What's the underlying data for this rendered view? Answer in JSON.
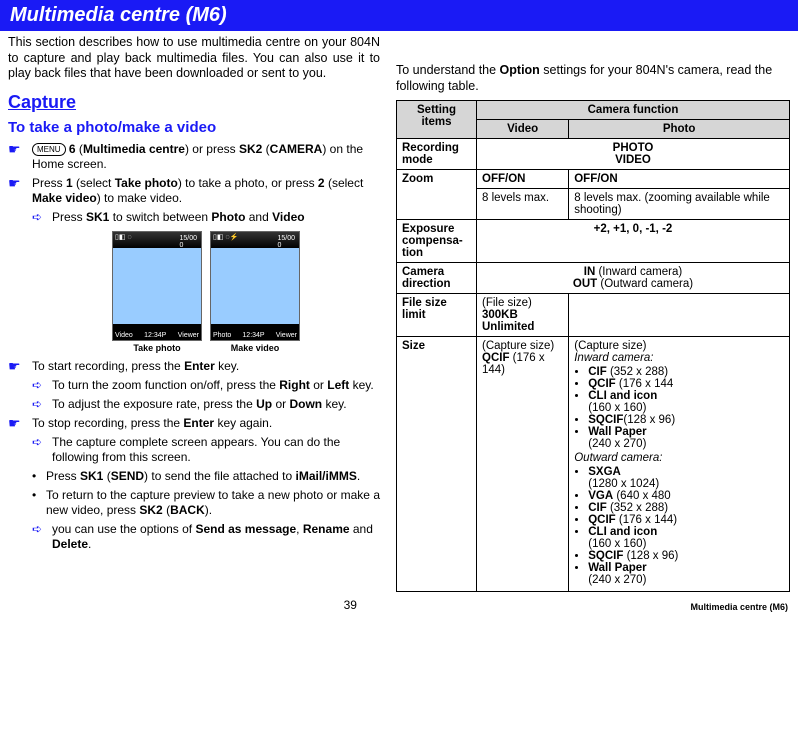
{
  "title": "Multimedia centre (M6)",
  "intro": "This section describes how to use multimedia centre on your 804N to capture and play back multimedia files. You can also use it to play back files that have been downloaded or sent to you.",
  "section_capture": "Capture",
  "sub_take": "To take a photo/make a video",
  "menu_badge": "MENU",
  "step1_a": "6",
  "step1_b": " (",
  "step1_c": "Multimedia centre",
  "step1_d": ") or press ",
  "step1_e": "SK2",
  "step1_f": " (",
  "step1_g": "CAMERA",
  "step1_h": ") on the Home screen.",
  "step2_a": "Press ",
  "step2_b": "1",
  "step2_c": " (select ",
  "step2_d": "Take photo",
  "step2_e": ") to take a photo, or press ",
  "step2_f": "2",
  "step2_g": " (select ",
  "step2_h": "Make video",
  "step2_i": ") to make video.",
  "step2_sub_a": "Press ",
  "step2_sub_b": "SK1",
  "step2_sub_c": " to switch between ",
  "step2_sub_d": "Photo",
  "step2_sub_e": " and ",
  "step2_sub_f": "Video",
  "shot_label_1": "Take photo",
  "shot_label_2": "Make video",
  "step3_a": "To start recording, press the ",
  "step3_b": "Enter",
  "step3_c": " key.",
  "step3_sub1_a": "To turn the zoom function on/off, press the ",
  "step3_sub1_b": "Right",
  "step3_sub1_c": " or ",
  "step3_sub1_d": "Left",
  "step3_sub1_e": " key.",
  "step3_sub2_a": "To adjust the exposure rate, press the ",
  "step3_sub2_b": "Up",
  "step3_sub2_c": " or ",
  "step3_sub2_d": "Down",
  "step3_sub2_e": " key.",
  "step4_a": "To stop recording, press the ",
  "step4_b": "Enter",
  "step4_c": " key again.",
  "step4_sub1": "The capture complete screen appears. You can do the following from this screen.",
  "step4_b1_a": "Press ",
  "step4_b1_b": "SK1",
  "step4_b1_c": " (",
  "step4_b1_d": "SEND",
  "step4_b1_e": ") to send the file attached to ",
  "step4_b1_f": "iMail/iMMS",
  "step4_b1_g": ".",
  "step4_b2_a": "To return to the capture preview to take a new photo or make a new video, press ",
  "step4_b2_b": "SK2",
  "step4_b2_c": " (",
  "step4_b2_d": "BACK",
  "step4_b2_e": ").",
  "step4_sub3_a": "you can use the options of ",
  "step4_sub3_b": "Send as message",
  "step4_sub3_c": ", ",
  "step4_sub3_d": "Rename",
  "step4_sub3_e": " and ",
  "step4_sub3_f": "Delete",
  "step4_sub3_g": ".",
  "right_intro_a": "To understand the ",
  "right_intro_b": "Option",
  "right_intro_c": " settings for your 804N's camera, read the following table.",
  "th_setting": "Setting items",
  "th_cam": "Camera function",
  "th_video": "Video",
  "th_photo": "Photo",
  "row_rec": "Recording mode",
  "rec_val": "PHOTO\nVIDEO",
  "row_zoom": "Zoom",
  "zoom_v": "OFF/ON",
  "zoom_p": "OFF/ON",
  "zoom_v2": "8 levels max.",
  "zoom_p2": "8 levels max. (zooming available while shooting)",
  "row_exp": "Exposure compensa-tion",
  "exp_val": "+2, +1, 0, -1, -2",
  "row_dir": "Camera direction",
  "dir_in_a": "IN",
  "dir_in_b": " (Inward camera)",
  "dir_out_a": "OUT",
  "dir_out_b": " (Outward camera)",
  "row_fs": "File size limit",
  "fs_a": "(File size)",
  "fs_b": "300KB",
  "fs_c": "Unlimited",
  "row_size": "Size",
  "size_v_a": "(Capture size)",
  "size_v_b": "QCIF",
  "size_v_c": " (176 x 144)",
  "size_p_a": "(Capture size)",
  "size_p_inward": "Inward camera:",
  "size_p_i1_a": "CIF",
  "size_p_i1_b": " (352 x 288)",
  "size_p_i2_a": "QCIF",
  "size_p_i2_b": " (176 x 144",
  "size_p_i3_a": "CLI and icon",
  "size_p_i3_b": "(160 x 160)",
  "size_p_i4_a": "SQCIF",
  "size_p_i4_b": "(128 x 96)",
  "size_p_i5_a": "Wall Paper",
  "size_p_i5_b": "(240 x 270)",
  "size_p_outward": "Outward camera:",
  "size_p_o1_a": "SXGA",
  "size_p_o1_b": "(1280 x 1024)",
  "size_p_o2_a": "VGA",
  "size_p_o2_b": " (640 x 480",
  "size_p_o3_a": "CIF",
  "size_p_o3_b": " (352 x 288)",
  "size_p_o4_a": "QCIF",
  "size_p_o4_b": " (176 x 144)",
  "size_p_o5_a": "CLI and icon",
  "size_p_o5_b": "(160 x 160)",
  "size_p_o6_a": "SQCIF",
  "size_p_o6_b": " (128 x 96)",
  "size_p_o7_a": "Wall Paper",
  "size_p_o7_b": "(240 x 270)",
  "page_num": "39",
  "chapter": "Multimedia centre (M6)"
}
